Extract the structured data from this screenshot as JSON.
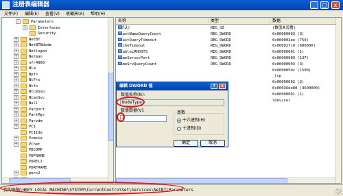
{
  "window": {
    "title": "注册表编辑器",
    "min_glyph": "_",
    "max_glyph": "□",
    "close_glyph": "x"
  },
  "menu": [
    "文件(F)",
    "编辑(E)",
    "查看(V)",
    "收藏夹(A)",
    "帮助(H)"
  ],
  "tree": {
    "items": [
      {
        "label": "Parameters",
        "expander": "-"
      },
      {
        "label": "Interfaces",
        "expander": "+"
      },
      {
        "label": "Security",
        "expander": ""
      },
      {
        "label": "NetBT",
        "expander": "+"
      },
      {
        "label": "NetBTNdsdm",
        "expander": "+"
      },
      {
        "label": "Netlogon",
        "expander": "+"
      },
      {
        "label": "Netman",
        "expander": "+"
      },
      {
        "label": "nfr4960",
        "expander": "+"
      },
      {
        "label": "Nla",
        "expander": "+"
      },
      {
        "label": "Npfs",
        "expander": "+"
      },
      {
        "label": "NtFrs",
        "expander": "+"
      },
      {
        "label": "Ntfs",
        "expander": "+"
      },
      {
        "label": "NtLmSsp",
        "expander": "+"
      },
      {
        "label": "NtmsSvc",
        "expander": "+"
      },
      {
        "label": "Null",
        "expander": "+"
      },
      {
        "label": "Parport",
        "expander": "+"
      },
      {
        "label": "PartMgr",
        "expander": "+"
      },
      {
        "label": "Parvdm",
        "expander": "+"
      },
      {
        "label": "PCI",
        "expander": "+"
      },
      {
        "label": "PCIIde",
        "expander": ""
      },
      {
        "label": "Pcmcia",
        "expander": "+"
      },
      {
        "label": "PCnet",
        "expander": "+"
      },
      {
        "label": "PDCOMP",
        "expander": ""
      },
      {
        "label": "PDFRAME",
        "expander": ""
      },
      {
        "label": "PDRELI",
        "expander": ""
      },
      {
        "label": "PDRFRAME",
        "expander": ""
      },
      {
        "label": "perc2",
        "expander": "+"
      },
      {
        "label": "perc2hib",
        "expander": "+"
      }
    ]
  },
  "list": {
    "columns": [
      "名称",
      "类型",
      "数据"
    ],
    "rows": [
      {
        "name": "(默认)",
        "type": "REG_SZ",
        "data": "(数值未设置)"
      },
      {
        "name": "BcastNameQueryCount",
        "type": "REG_DWORD",
        "data": "0x00000003 (3)"
      },
      {
        "name": "BcastQueryTimeout",
        "type": "REG_DWORD",
        "data": "0x000002ee (750)"
      },
      {
        "name": "CacheTimeout",
        "type": "REG_DWORD",
        "data": "0x000927c0 (600000)"
      },
      {
        "name": "EnableLMHOSTS",
        "type": "REG_DWORD",
        "data": "0x00000001 (1)"
      },
      {
        "name": "NameServerPort",
        "type": "REG_DWORD",
        "data": "0x00000089 (137)"
      },
      {
        "name": "NameSrvQueryCount",
        "type": "REG_DWORD",
        "data": "0x00000003 (3)"
      },
      {
        "name": "",
        "type": "",
        "data": "0x000005dc (1500)"
      },
      {
        "name": "",
        "type": "",
        "data": "_tcp"
      },
      {
        "name": "",
        "type": "",
        "data": "0x00000002 (2)"
      },
      {
        "name": "",
        "type": "",
        "data": "0x00036ee80 (3600000)"
      },
      {
        "name": "",
        "type": "",
        "data": "0x00000001 (1)"
      },
      {
        "name": "",
        "type": "",
        "data": "\\Device\\"
      }
    ]
  },
  "dialog": {
    "title": "编辑 DWORD 值",
    "help_glyph": "?",
    "close_glyph": "x",
    "name_label": "数值名称(N):",
    "name_value": "NodeType",
    "data_label": "数值数据(V):",
    "data_value": "4",
    "base_label": "基数",
    "radio_hex": "十六进制(H)",
    "radio_dec": "十进制(D)",
    "ok": "确定",
    "cancel": "取消"
  },
  "status": {
    "path": "我的电脑\\HKEY_LOCAL_MACHINE\\SYSTEM\\CurrentControlSet\\Services\\NetBT\\Parameters"
  },
  "colors": {
    "titlebar": "#0842a8",
    "highlight_ring": "#e0101a"
  }
}
